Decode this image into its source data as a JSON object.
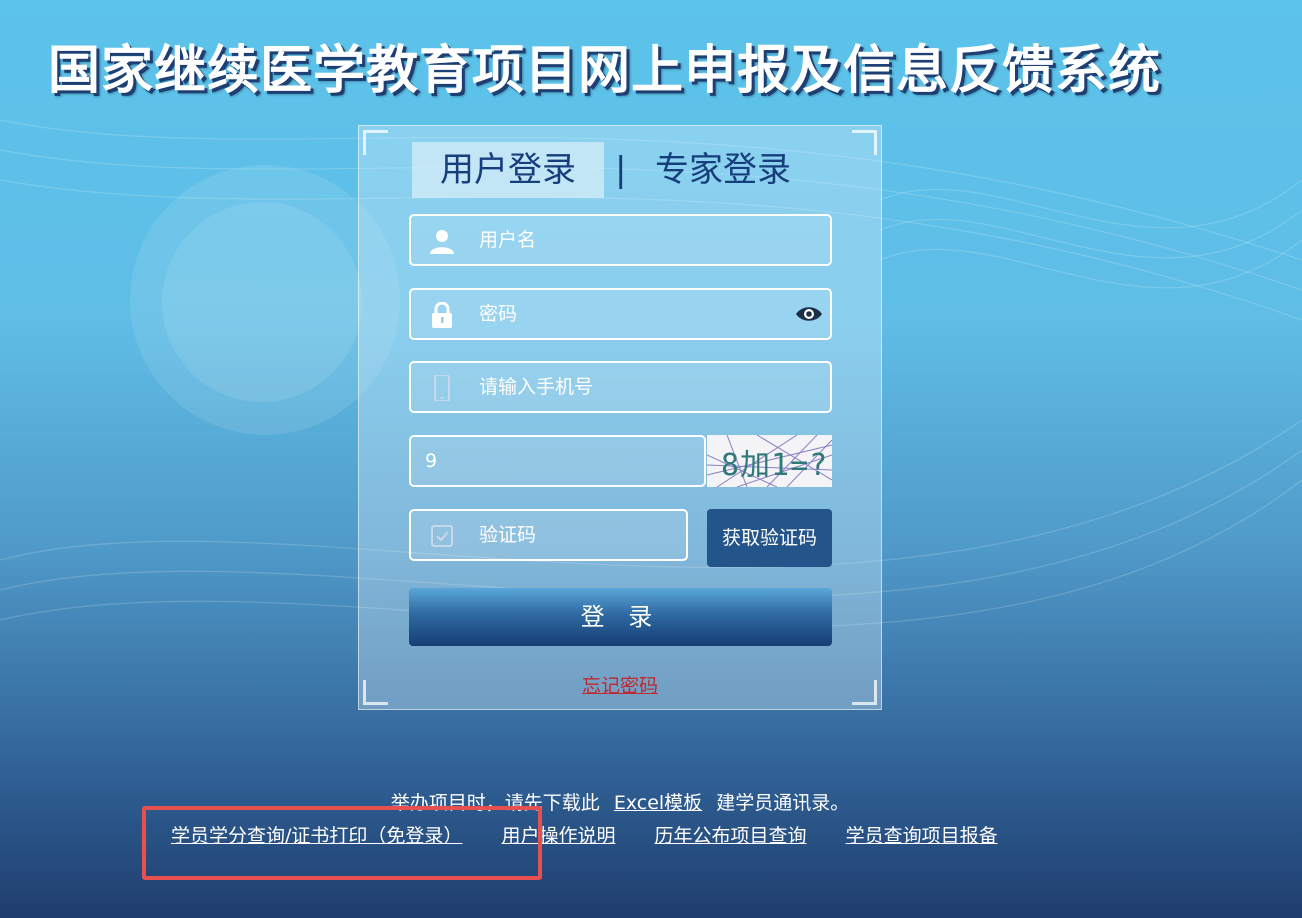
{
  "page": {
    "title": "国家继续医学教育项目网上申报及信息反馈系统"
  },
  "login": {
    "tabs": {
      "user": "用户登录",
      "separator": "|",
      "expert": "专家登录"
    },
    "username_placeholder": "用户名",
    "password_placeholder": "密码",
    "phone_placeholder": "请输入手机号",
    "captcha_value": "9",
    "captcha_image_text": "8加1=?",
    "sms_code_placeholder": "验证码",
    "get_code_button": "获取验证码",
    "submit_button": "登 录",
    "forgot_password": "忘记密码"
  },
  "footer": {
    "note_prefix": "举办项目时，请先下载此",
    "note_link": "Excel模板",
    "note_suffix": "建学员通讯录。",
    "links": [
      "学员学分查询/证书打印（免登录）",
      "用户操作说明",
      "历年公布项目查询",
      "学员查询项目报备"
    ]
  },
  "colors": {
    "title_shadow": "#1d3f74",
    "tab_text": "#163e7d",
    "button_bg": "#23548a",
    "forgot_link": "#c0282d",
    "highlight_box": "#e8504f"
  },
  "icons": [
    "user-icon",
    "lock-icon",
    "eye-icon",
    "phone-icon",
    "checkbox-icon"
  ]
}
